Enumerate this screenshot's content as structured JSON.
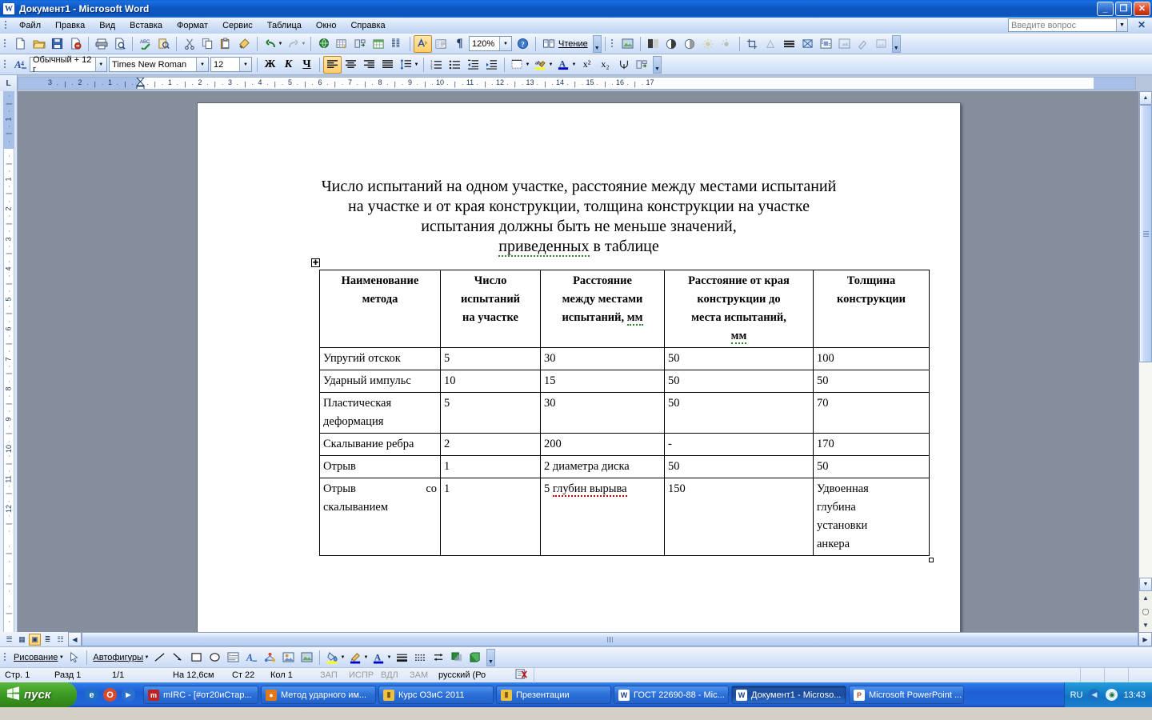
{
  "window": {
    "title": "Документ1 - Microsoft Word",
    "app_icon": "word-document-icon",
    "minimize": "–",
    "restore": "❐",
    "close": "✕"
  },
  "menu": {
    "items": [
      {
        "label": "Файл",
        "acc": "Ф"
      },
      {
        "label": "Правка",
        "acc": "П"
      },
      {
        "label": "Вид",
        "acc": "В"
      },
      {
        "label": "Вставка",
        "acc": "а"
      },
      {
        "label": "Формат",
        "acc": "м"
      },
      {
        "label": "Сервис",
        "acc": "р"
      },
      {
        "label": "Таблица",
        "acc": "Т"
      },
      {
        "label": "Окно",
        "acc": "О"
      },
      {
        "label": "Справка",
        "acc": "С"
      }
    ],
    "ask_placeholder": "Введите вопрос",
    "ask_value": ""
  },
  "standard_toolbar": {
    "buttons": [
      "new-document-icon",
      "open-folder-icon",
      "save-icon",
      "permission-icon",
      "print-icon",
      "print-preview-icon",
      "spelling-check-icon",
      "research-icon",
      "cut-scissors-icon",
      "copy-icon",
      "paste-icon",
      "format-painter-icon",
      "undo-icon",
      "undo-dropdown-icon",
      "redo-icon",
      "redo-dropdown-icon",
      "insert-hyperlink-icon",
      "insert-table-icon",
      "insert-columns-icon",
      "insert-excel-sheet-icon",
      "columns-icon",
      "drawing-icon",
      "document-map-icon",
      "show-formatting-marks-icon"
    ],
    "zoom_value": "120%",
    "help_icon": "help-question-icon",
    "reading_label": "Чтение",
    "reading_icon": "reading-layout-icon"
  },
  "formatting_toolbar": {
    "styles_icon": "styles-and-formatting-icon",
    "style_value": "Обычный + 12 г",
    "font_value": "Times New Roman",
    "size_value": "12",
    "bold_label": "Ж",
    "italic_label": "К",
    "underline_label": "Ч",
    "align_left_icon": "align-left-icon",
    "align_center_icon": "align-center-icon",
    "align_right_icon": "align-right-icon",
    "align_justify_icon": "align-justify-icon",
    "line_spacing_icon": "line-spacing-icon",
    "numbered_list_icon": "numbered-list-icon",
    "bulleted_list_icon": "bulleted-list-icon",
    "decrease_indent_icon": "decrease-indent-icon",
    "increase_indent_icon": "increase-indent-icon",
    "borders_icon": "borders-icon",
    "highlight_icon": "highlight-color-icon",
    "font_color_icon": "font-color-icon",
    "superscript_label": "x²",
    "subscript_label": "x₂",
    "active_alignment": "align-left-icon"
  },
  "picture_toolbar": {
    "buttons": [
      "insert-picture-icon",
      "color-mode-icon",
      "more-contrast-icon",
      "less-contrast-icon",
      "more-brightness-icon",
      "less-brightness-icon",
      "crop-icon",
      "rotate-left-icon",
      "line-style-icon",
      "compress-pictures-icon",
      "text-wrapping-icon",
      "format-picture-icon",
      "set-transparent-color-icon",
      "reset-picture-icon"
    ]
  },
  "ruler": {
    "corner_label": "L",
    "horizontal_left_labels": [
      "3",
      "2",
      "1"
    ],
    "horizontal_right_labels": [
      "1",
      "2",
      "3",
      "4",
      "5",
      "6",
      "7",
      "8",
      "9",
      "10",
      "11",
      "12",
      "13",
      "14",
      "15",
      "16",
      "17"
    ],
    "vertical_labels": [
      "2",
      "1",
      "1",
      "2",
      "3",
      "4",
      "5",
      "6",
      "7",
      "8",
      "9",
      "10",
      "11",
      "12"
    ]
  },
  "document": {
    "title_lines": [
      "Число испытаний на одном участке, расстояние между местами испытаний",
      "на участке и от края конструкции, толщина конструкции на участке",
      "испытания должны быть не меньше значений,"
    ],
    "title_last_line_spelled": "приведенных",
    "title_last_line_rest": " в таблице",
    "table_handle_icon": "table-move-handle-icon",
    "table": {
      "headers": [
        "Наименование\nметода",
        "Число\nиспытаний\nна участке",
        "Расстояние\nмежду местами\nиспытаний, мм",
        "Расстояние от края\nконструкции до\nместа испытаний,\nмм",
        "Толщина\nконструкции"
      ],
      "header_cells": [
        {
          "lines": [
            "Наименование",
            "метода"
          ],
          "spell": []
        },
        {
          "lines": [
            "Число",
            "испытаний",
            "на участке"
          ],
          "spell": []
        },
        {
          "lines": [
            "Расстояние",
            "между местами",
            "испытаний, мм"
          ],
          "spell": [
            "мм"
          ]
        },
        {
          "lines": [
            "Расстояние от края",
            "конструкции до",
            "места испытаний,",
            "мм"
          ],
          "spell": [
            "мм"
          ]
        },
        {
          "lines": [
            "Толщина",
            "конструкции"
          ],
          "spell": []
        }
      ],
      "rows": [
        {
          "method": "Упругий отскок",
          "tests": "5",
          "between": "30",
          "edge": "50",
          "thickness": "100"
        },
        {
          "method": "Ударный импульс",
          "tests": "10",
          "between": "15",
          "edge": "50",
          "thickness": "50"
        },
        {
          "method": "Пластическая деформация",
          "tests": "5",
          "between": "30",
          "edge": "50",
          "thickness": "70"
        },
        {
          "method": "Скалывание ребра",
          "tests": "2",
          "between": "200",
          "edge": "-",
          "thickness": "170"
        },
        {
          "method": "Отрыв",
          "tests": "1",
          "between": "2 диаметра диска",
          "edge": "50",
          "thickness": "50"
        },
        {
          "method": "Отрыв со скалыванием",
          "tests": "1",
          "between": "5 глубин вырыва",
          "edge": "150",
          "thickness": "Удвоенная глубина установки анкера",
          "justify_method": true,
          "spell_between": "вырыва"
        }
      ]
    }
  },
  "view_buttons": [
    {
      "name": "normal-view-icon",
      "active": false
    },
    {
      "name": "web-layout-view-icon",
      "active": false
    },
    {
      "name": "print-layout-view-icon",
      "active": true
    },
    {
      "name": "outline-view-icon",
      "active": false
    },
    {
      "name": "reading-layout-view-icon",
      "active": false
    }
  ],
  "drawing_toolbar": {
    "menu_label": "Рисование",
    "menu_acc": "Р",
    "select_icon": "select-objects-arrow-icon",
    "autoshapes_label": "Автофигуры",
    "autoshapes_acc": "г",
    "buttons": [
      "line-icon",
      "arrow-icon",
      "rectangle-icon",
      "oval-icon",
      "text-box-icon",
      "wordart-icon",
      "diagram-icon",
      "clip-art-icon",
      "insert-picture-icon",
      "fill-color-icon",
      "line-color-icon",
      "font-color-icon",
      "line-style-icon",
      "dash-style-icon",
      "arrow-style-icon",
      "shadow-style-icon",
      "3d-style-icon"
    ]
  },
  "statusbar": {
    "page": "Стр.  1",
    "section": "Разд  1",
    "pages": "1/1",
    "position": "На 12,6см",
    "line": "Ст  22",
    "column": "Кол  1",
    "rec": "ЗАП",
    "trk": "ИСПР",
    "ext": "ВДЛ",
    "ovr": "ЗАМ",
    "language": "русский (Ро",
    "spell_icon": "spelling-status-icon"
  },
  "taskbar": {
    "start_label": "пуск",
    "start_icon": "windows-flag-icon",
    "quick_launch": [
      {
        "name": "internet-explorer-icon",
        "glyph": "e",
        "color": "#1f6fc4"
      },
      {
        "name": "opera-browser-icon",
        "glyph": "O",
        "color": "#d94a2b"
      },
      {
        "name": "media-player-icon",
        "glyph": "▶",
        "color": "#2b6fd0"
      }
    ],
    "tasks": [
      {
        "label": "mIRC - [#от20иСтар...",
        "icon": "mirc-icon",
        "icon_color": "#c02020",
        "icon_glyph": "m",
        "active": false
      },
      {
        "label": "Метод ударного им...",
        "icon": "firefox-icon",
        "icon_color": "#e07818",
        "icon_glyph": "ff",
        "active": false
      },
      {
        "label": "Курс ОЗиС 2011",
        "icon": "folder-icon",
        "icon_color": "#f0c040",
        "icon_glyph": "▤",
        "active": false
      },
      {
        "label": "Презентации",
        "icon": "folder-icon",
        "icon_color": "#f0c040",
        "icon_glyph": "▤",
        "active": false
      },
      {
        "label": "ГОСТ 22690-88 - Mic...",
        "icon": "word-document-icon",
        "icon_color": "#ffffff",
        "icon_glyph": "W",
        "active": false
      },
      {
        "label": "Документ1 - Microso...",
        "icon": "word-document-icon",
        "icon_color": "#ffffff",
        "icon_glyph": "W",
        "active": true
      },
      {
        "label": "Microsoft PowerPoint ...",
        "icon": "powerpoint-icon",
        "icon_color": "#ffffff",
        "icon_glyph": "P",
        "active": false
      }
    ],
    "language": "RU",
    "tray_icons": [
      "volume-icon",
      "antivirus-icon"
    ],
    "clock": "13:43"
  },
  "colors": {
    "title_bar": "#0d56c0",
    "toolbar_bg": "#dce8fa",
    "page_bg": "#ffffff",
    "workspace_bg": "#868e9e",
    "accent_orange": "#ffcd66",
    "taskbar_blue": "#1d5fd4",
    "start_green": "#3d9c25",
    "spell_green": "#2b8a2b",
    "spell_red": "#c00000"
  }
}
